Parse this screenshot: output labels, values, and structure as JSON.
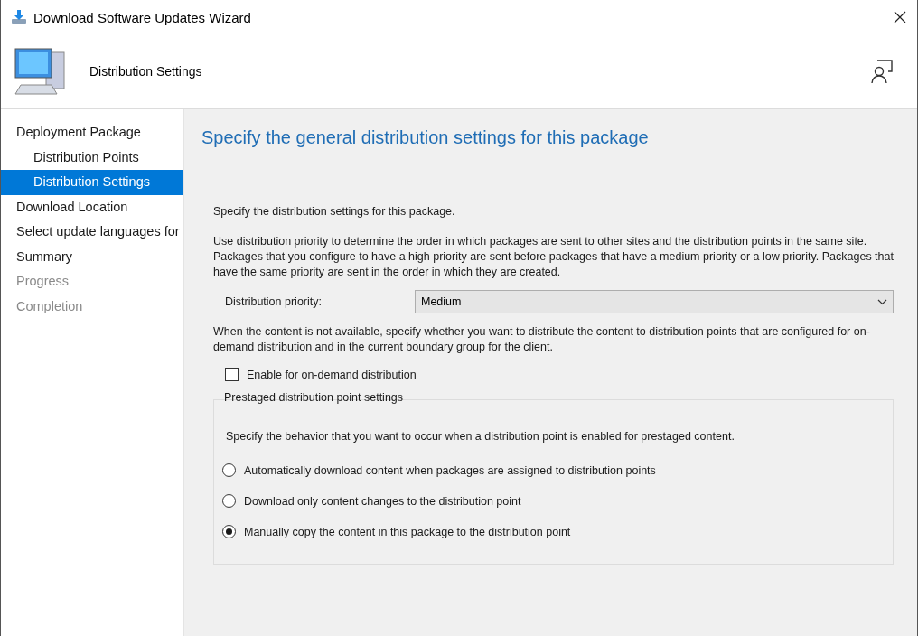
{
  "window": {
    "title": "Download Software Updates Wizard"
  },
  "header": {
    "title": "Distribution Settings"
  },
  "sidebar": {
    "items": [
      {
        "label": "Deployment Package",
        "selected": false,
        "disabled": false,
        "children": [
          {
            "label": "Distribution Points",
            "selected": false,
            "disabled": false
          },
          {
            "label": "Distribution Settings",
            "selected": true,
            "disabled": false
          }
        ]
      },
      {
        "label": "Download Location",
        "selected": false,
        "disabled": false
      },
      {
        "label": "Select update languages for",
        "selected": false,
        "disabled": false
      },
      {
        "label": "Summary",
        "selected": false,
        "disabled": false
      },
      {
        "label": "Progress",
        "selected": false,
        "disabled": true
      },
      {
        "label": "Completion",
        "selected": false,
        "disabled": true
      }
    ]
  },
  "page": {
    "heading": "Specify the general distribution settings for this package",
    "intro": "Specify the distribution settings for this package.",
    "priority_text": "Use distribution priority to determine the order in which packages are sent to other sites and the distribution points in the same site. Packages that you configure to have a high priority are sent before packages that have a medium priority or a low priority. Packages that have the same priority are sent in the order in which they are created.",
    "priority_field": {
      "label": "Distribution priority:",
      "value": "Medium"
    },
    "on_demand_text": "When the content is not available, specify whether you want to distribute the content to distribution points that are configured for on-demand distribution and in the current boundary group for the client.",
    "on_demand_checkbox": {
      "label": "Enable for on-demand distribution",
      "checked": false
    },
    "prestaged": {
      "title": "Prestaged distribution point settings",
      "description": "Specify the behavior that you want to occur when a distribution point is enabled for prestaged content.",
      "options": [
        {
          "label": "Automatically download content when packages are assigned to distribution points",
          "selected": false
        },
        {
          "label": "Download only content changes to the distribution point",
          "selected": false
        },
        {
          "label": "Manually copy the content in this package to the distribution point",
          "selected": true
        }
      ]
    }
  }
}
